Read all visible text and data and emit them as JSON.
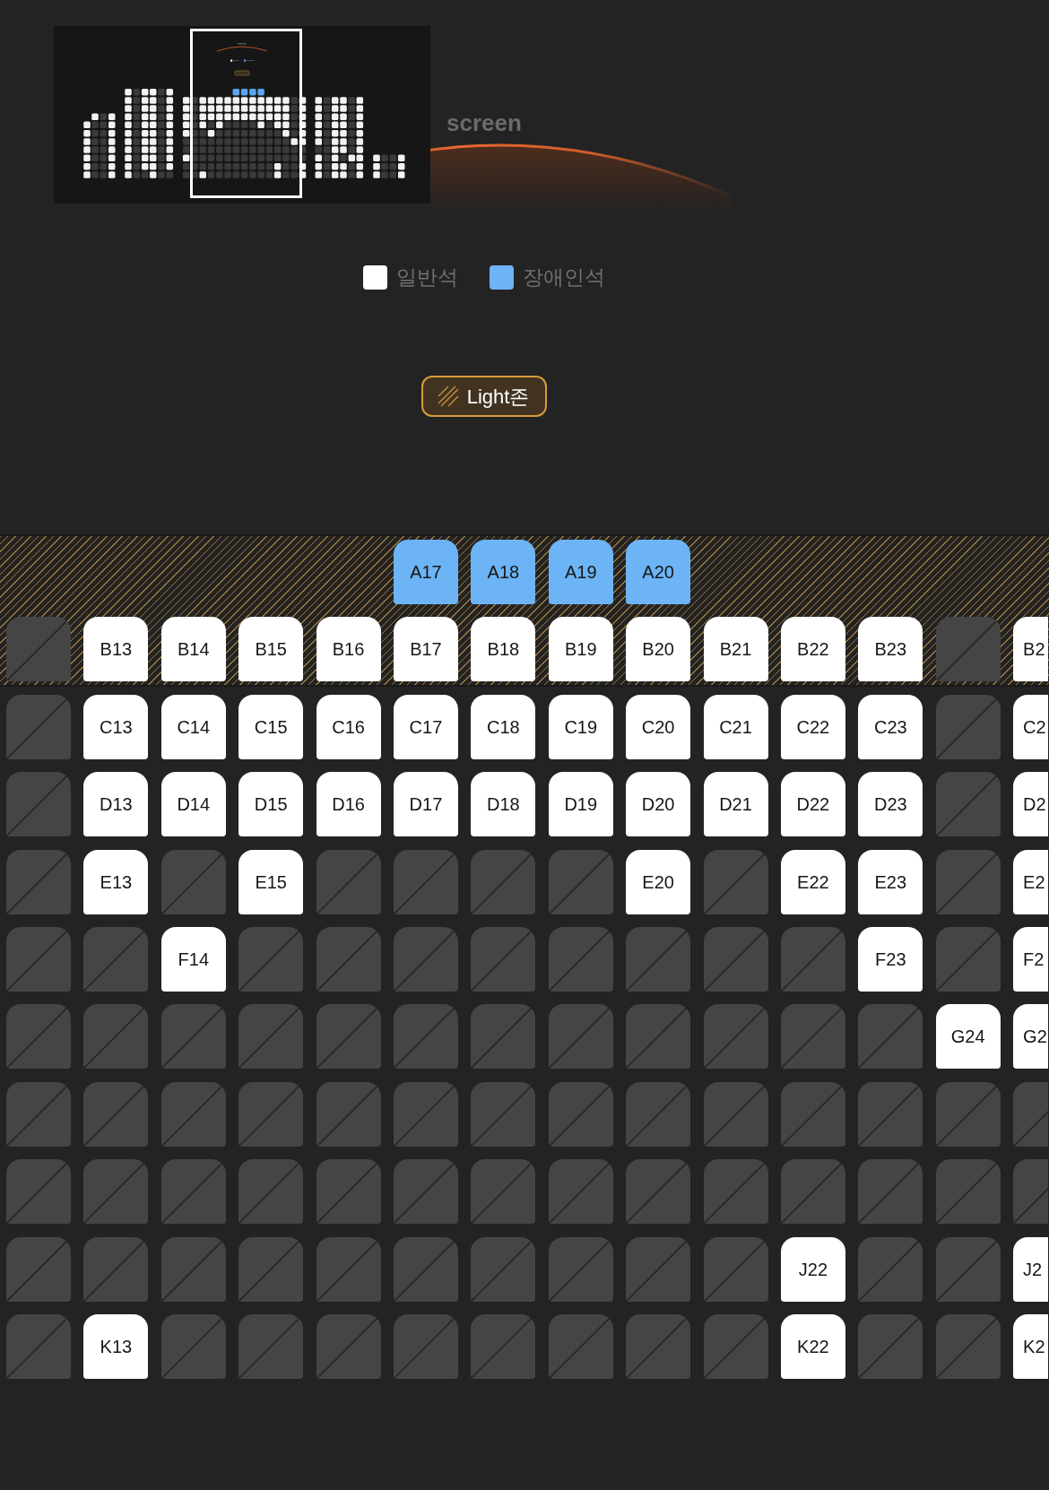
{
  "screen": {
    "label": "screen"
  },
  "legend": [
    {
      "label": "일반석",
      "color": "#ffffff"
    },
    {
      "label": "장애인석",
      "color": "#6cb4f5"
    }
  ],
  "light_zone_button": {
    "label": "Light존"
  },
  "seat_map": {
    "zones": [
      {
        "kind": "light",
        "rows": [
          {
            "seats": [
              {
                "kind": "space"
              },
              {
                "kind": "space"
              },
              {
                "kind": "space"
              },
              {
                "kind": "space"
              },
              {
                "kind": "space"
              },
              {
                "kind": "accessible",
                "label": "A17"
              },
              {
                "kind": "accessible",
                "label": "A18"
              },
              {
                "kind": "accessible",
                "label": "A19"
              },
              {
                "kind": "accessible",
                "label": "A20"
              },
              {
                "kind": "space"
              },
              {
                "kind": "space"
              },
              {
                "kind": "space"
              },
              {
                "kind": "space"
              },
              {
                "kind": "space"
              }
            ]
          },
          {
            "seats": [
              {
                "kind": "taken"
              },
              {
                "kind": "standard",
                "label": "B13"
              },
              {
                "kind": "standard",
                "label": "B14"
              },
              {
                "kind": "standard",
                "label": "B15"
              },
              {
                "kind": "standard",
                "label": "B16"
              },
              {
                "kind": "standard",
                "label": "B17"
              },
              {
                "kind": "standard",
                "label": "B18"
              },
              {
                "kind": "standard",
                "label": "B19"
              },
              {
                "kind": "standard",
                "label": "B20"
              },
              {
                "kind": "standard",
                "label": "B21"
              },
              {
                "kind": "standard",
                "label": "B22"
              },
              {
                "kind": "standard",
                "label": "B23"
              },
              {
                "kind": "taken"
              },
              {
                "kind": "standard",
                "label": "B2"
              }
            ]
          }
        ]
      },
      {
        "kind": "regular",
        "rows": [
          {
            "seats": [
              {
                "kind": "taken"
              },
              {
                "kind": "standard",
                "label": "C13"
              },
              {
                "kind": "standard",
                "label": "C14"
              },
              {
                "kind": "standard",
                "label": "C15"
              },
              {
                "kind": "standard",
                "label": "C16"
              },
              {
                "kind": "standard",
                "label": "C17"
              },
              {
                "kind": "standard",
                "label": "C18"
              },
              {
                "kind": "standard",
                "label": "C19"
              },
              {
                "kind": "standard",
                "label": "C20"
              },
              {
                "kind": "standard",
                "label": "C21"
              },
              {
                "kind": "standard",
                "label": "C22"
              },
              {
                "kind": "standard",
                "label": "C23"
              },
              {
                "kind": "taken"
              },
              {
                "kind": "standard",
                "label": "C2"
              }
            ]
          },
          {
            "seats": [
              {
                "kind": "taken"
              },
              {
                "kind": "standard",
                "label": "D13"
              },
              {
                "kind": "standard",
                "label": "D14"
              },
              {
                "kind": "standard",
                "label": "D15"
              },
              {
                "kind": "standard",
                "label": "D16"
              },
              {
                "kind": "standard",
                "label": "D17"
              },
              {
                "kind": "standard",
                "label": "D18"
              },
              {
                "kind": "standard",
                "label": "D19"
              },
              {
                "kind": "standard",
                "label": "D20"
              },
              {
                "kind": "standard",
                "label": "D21"
              },
              {
                "kind": "standard",
                "label": "D22"
              },
              {
                "kind": "standard",
                "label": "D23"
              },
              {
                "kind": "taken"
              },
              {
                "kind": "standard",
                "label": "D2"
              }
            ]
          },
          {
            "seats": [
              {
                "kind": "taken"
              },
              {
                "kind": "standard",
                "label": "E13"
              },
              {
                "kind": "taken"
              },
              {
                "kind": "standard",
                "label": "E15"
              },
              {
                "kind": "taken"
              },
              {
                "kind": "taken"
              },
              {
                "kind": "taken"
              },
              {
                "kind": "taken"
              },
              {
                "kind": "standard",
                "label": "E20"
              },
              {
                "kind": "taken"
              },
              {
                "kind": "standard",
                "label": "E22"
              },
              {
                "kind": "standard",
                "label": "E23"
              },
              {
                "kind": "taken"
              },
              {
                "kind": "standard",
                "label": "E2"
              }
            ]
          },
          {
            "seats": [
              {
                "kind": "taken"
              },
              {
                "kind": "taken"
              },
              {
                "kind": "standard",
                "label": "F14"
              },
              {
                "kind": "taken"
              },
              {
                "kind": "taken"
              },
              {
                "kind": "taken"
              },
              {
                "kind": "taken"
              },
              {
                "kind": "taken"
              },
              {
                "kind": "taken"
              },
              {
                "kind": "taken"
              },
              {
                "kind": "taken"
              },
              {
                "kind": "standard",
                "label": "F23"
              },
              {
                "kind": "taken"
              },
              {
                "kind": "standard",
                "label": "F2"
              }
            ]
          },
          {
            "seats": [
              {
                "kind": "taken"
              },
              {
                "kind": "taken"
              },
              {
                "kind": "taken"
              },
              {
                "kind": "taken"
              },
              {
                "kind": "taken"
              },
              {
                "kind": "taken"
              },
              {
                "kind": "taken"
              },
              {
                "kind": "taken"
              },
              {
                "kind": "taken"
              },
              {
                "kind": "taken"
              },
              {
                "kind": "taken"
              },
              {
                "kind": "taken"
              },
              {
                "kind": "standard",
                "label": "G24"
              },
              {
                "kind": "standard",
                "label": "G2"
              }
            ]
          },
          {
            "seats": [
              {
                "kind": "taken"
              },
              {
                "kind": "taken"
              },
              {
                "kind": "taken"
              },
              {
                "kind": "taken"
              },
              {
                "kind": "taken"
              },
              {
                "kind": "taken"
              },
              {
                "kind": "taken"
              },
              {
                "kind": "taken"
              },
              {
                "kind": "taken"
              },
              {
                "kind": "taken"
              },
              {
                "kind": "taken"
              },
              {
                "kind": "taken"
              },
              {
                "kind": "taken"
              },
              {
                "kind": "taken"
              }
            ]
          },
          {
            "seats": [
              {
                "kind": "taken"
              },
              {
                "kind": "taken"
              },
              {
                "kind": "taken"
              },
              {
                "kind": "taken"
              },
              {
                "kind": "taken"
              },
              {
                "kind": "taken"
              },
              {
                "kind": "taken"
              },
              {
                "kind": "taken"
              },
              {
                "kind": "taken"
              },
              {
                "kind": "taken"
              },
              {
                "kind": "taken"
              },
              {
                "kind": "taken"
              },
              {
                "kind": "taken"
              },
              {
                "kind": "taken"
              }
            ]
          },
          {
            "seats": [
              {
                "kind": "taken"
              },
              {
                "kind": "taken"
              },
              {
                "kind": "taken"
              },
              {
                "kind": "taken"
              },
              {
                "kind": "taken"
              },
              {
                "kind": "taken"
              },
              {
                "kind": "taken"
              },
              {
                "kind": "taken"
              },
              {
                "kind": "taken"
              },
              {
                "kind": "taken"
              },
              {
                "kind": "standard",
                "label": "J22"
              },
              {
                "kind": "taken"
              },
              {
                "kind": "taken"
              },
              {
                "kind": "standard",
                "label": "J2"
              }
            ]
          },
          {
            "seats": [
              {
                "kind": "taken"
              },
              {
                "kind": "standard",
                "label": "K13"
              },
              {
                "kind": "taken"
              },
              {
                "kind": "taken"
              },
              {
                "kind": "taken"
              },
              {
                "kind": "taken"
              },
              {
                "kind": "taken"
              },
              {
                "kind": "taken"
              },
              {
                "kind": "taken"
              },
              {
                "kind": "taken"
              },
              {
                "kind": "standard",
                "label": "K22"
              },
              {
                "kind": "taken"
              },
              {
                "kind": "taken"
              },
              {
                "kind": "standard",
                "label": "K2"
              }
            ]
          }
        ]
      }
    ]
  }
}
